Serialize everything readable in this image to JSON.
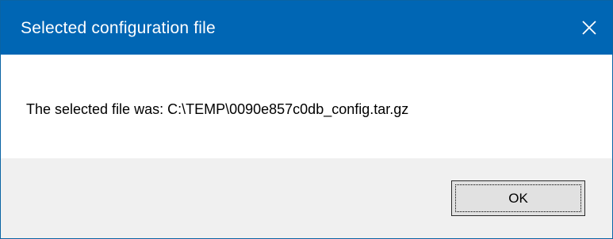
{
  "window": {
    "title": "Selected configuration file",
    "close_icon": "close-icon",
    "titlebar_color": "#0066b4"
  },
  "content": {
    "message": "The selected file was: C:\\TEMP\\0090e857c0db_config.tar.gz"
  },
  "footer": {
    "ok_label": "OK"
  }
}
